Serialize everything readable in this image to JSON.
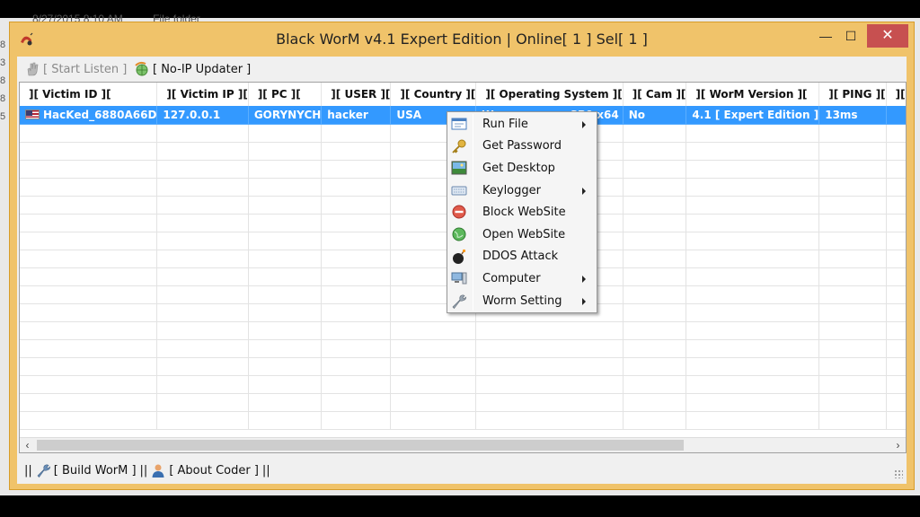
{
  "background": {
    "explorer_row": [
      "8/27/2015 8:10 AM",
      "File folder"
    ],
    "left_numbers": [
      "8",
      "3",
      "8",
      "8",
      "5"
    ]
  },
  "window": {
    "title": "Black WorM v4.1 Expert Edition | Online[ 1 ] Sel[ 1 ]",
    "minimize": "—",
    "maximize": "☐",
    "close": "✕",
    "colors": {
      "frame": "#f0c36a",
      "close": "#c75050",
      "selection": "#3399ff"
    }
  },
  "toolbar": {
    "start_listen": "[ Start Listen ]",
    "noip_updater": "[ No-IP Updater ]"
  },
  "grid": {
    "columns": [
      "][ Victim ID ][",
      "][ Victim IP ][",
      "][ PC ][",
      "][ USER ][",
      "][ Country ][",
      "][ Operating System ][",
      "][ Cam ][",
      "][ WorM Version ][",
      "][ PING ][",
      "][ A"
    ],
    "rows": [
      {
        "victim_id": "HacKed_6880A66D",
        "victim_ip": "127.0.0.1",
        "pc": "GORYNYCH",
        "user": "hacker",
        "country": "USA",
        "os_start": "W",
        "os_end": "SP0 x64",
        "cam": "No",
        "version": "4.1 [ Expert Edition ]",
        "ping": "13ms",
        "extra": ""
      }
    ]
  },
  "context_menu": [
    {
      "label": "Run File",
      "icon": "run-file-icon",
      "submenu": true
    },
    {
      "label": "Get Password",
      "icon": "key-icon",
      "submenu": false
    },
    {
      "label": "Get Desktop",
      "icon": "desktop-icon",
      "submenu": false
    },
    {
      "label": "Keylogger",
      "icon": "keyboard-icon",
      "submenu": true
    },
    {
      "label": "Block WebSite",
      "icon": "block-icon",
      "submenu": false
    },
    {
      "label": "Open WebSite",
      "icon": "globe-icon",
      "submenu": false
    },
    {
      "label": "DDOS Attack",
      "icon": "bomb-icon",
      "submenu": false
    },
    {
      "label": "Computer",
      "icon": "computer-icon",
      "submenu": true
    },
    {
      "label": "Worm Setting",
      "icon": "wrench-icon",
      "submenu": true
    }
  ],
  "statusbar": {
    "sep": "||",
    "build_worm": "[ Build WorM ]",
    "about_coder": "[ About Coder ]"
  }
}
